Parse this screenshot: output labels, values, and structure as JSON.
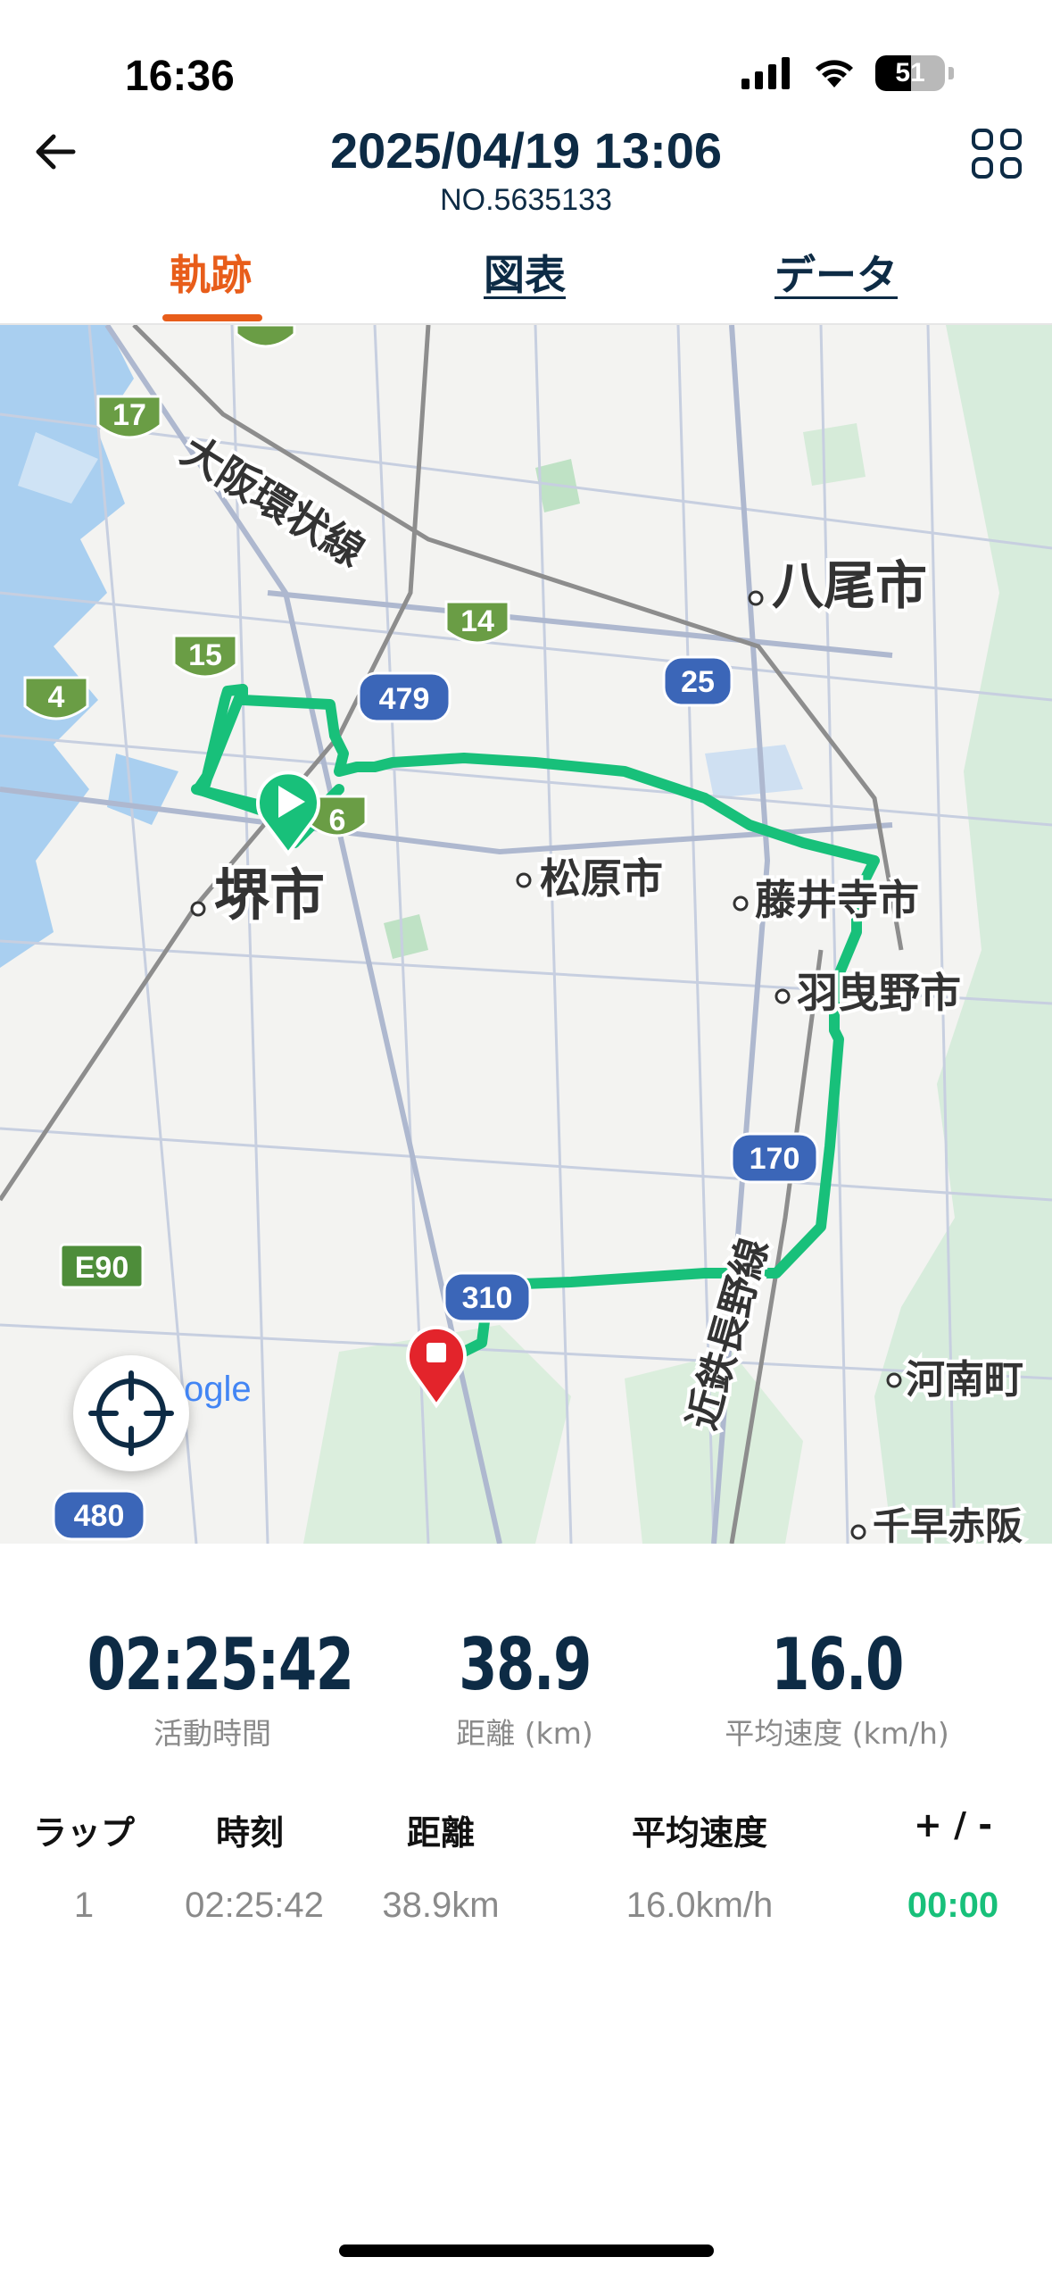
{
  "status_bar": {
    "time": "16:36",
    "battery": "51",
    "battery_level_percent": 51
  },
  "header": {
    "title": "2025/04/19 13:06",
    "subtitle": "NO.5635133"
  },
  "tabs": [
    {
      "label": "軌跡",
      "active": true
    },
    {
      "label": "図表",
      "active": false
    },
    {
      "label": "データ",
      "active": false
    }
  ],
  "map": {
    "labels": {
      "osaka_loop": "大阪環状線",
      "yao": "八尾市",
      "sakai": "堺市",
      "matsubara": "松原市",
      "fujiidera": "藤井寺市",
      "habikino": "羽曳野市",
      "kintetsu": "近鉄長野線",
      "kanan": "河南町",
      "chihaya": "千早赤阪"
    },
    "route_shields": [
      "17",
      "14",
      "15",
      "4",
      "479",
      "25",
      "6",
      "170",
      "E90",
      "310",
      "480"
    ],
    "google_logo": "ogle",
    "route_color": "#18c07a",
    "start_marker_color": "#18c07a",
    "end_marker_color": "#e3242b"
  },
  "stats": [
    {
      "value": "02:25:42",
      "label": "活動時間"
    },
    {
      "value": "38.9",
      "label": "距離 (km)"
    },
    {
      "value": "16.0",
      "label": "平均速度 (km/h)"
    }
  ],
  "laps": {
    "headers": [
      "ラップ",
      "時刻",
      "距離",
      "平均速度",
      "+ / -"
    ],
    "rows": [
      {
        "lap": "1",
        "time": "02:25:42",
        "distance": "38.9km",
        "speed": "16.0km/h",
        "diff": "00:00"
      }
    ]
  }
}
